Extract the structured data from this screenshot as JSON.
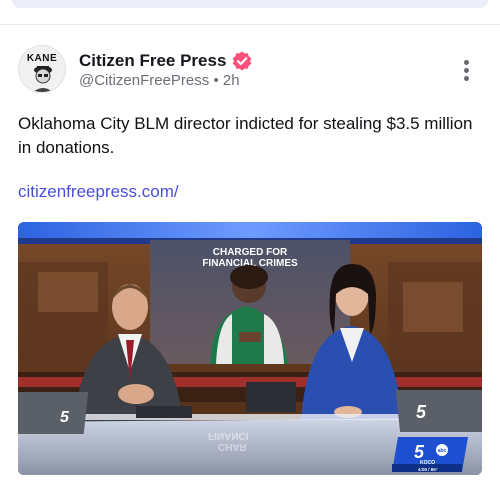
{
  "post": {
    "author_name": "Citizen Free Press",
    "handle": "@CitizenFreePress",
    "separator": "•",
    "time": "2h",
    "text": "Oklahoma City BLM director indicted for stealing $3.5 million in donations.",
    "link": "citizenfreepress.com/",
    "avatar_text": "KANE"
  },
  "video": {
    "graphic_line1": "CHARGED FOR",
    "graphic_line2": "FINANCIAL CRIMES",
    "desk_logo_left": "5",
    "desk_logo_right": "5",
    "reflection_text": "FINANCI",
    "reflection_text2": "CHAR",
    "bug_number": "5",
    "bug_network": "abc",
    "bug_station": "KOCO",
    "bug_time": "4:00 / 65°"
  },
  "colors": {
    "verified": "#ff4f7b",
    "link": "#4a4fd8",
    "bug_blue": "#1d4fd0"
  },
  "icons": {
    "verified": "verified-badge-icon",
    "more": "more-vertical-icon"
  }
}
